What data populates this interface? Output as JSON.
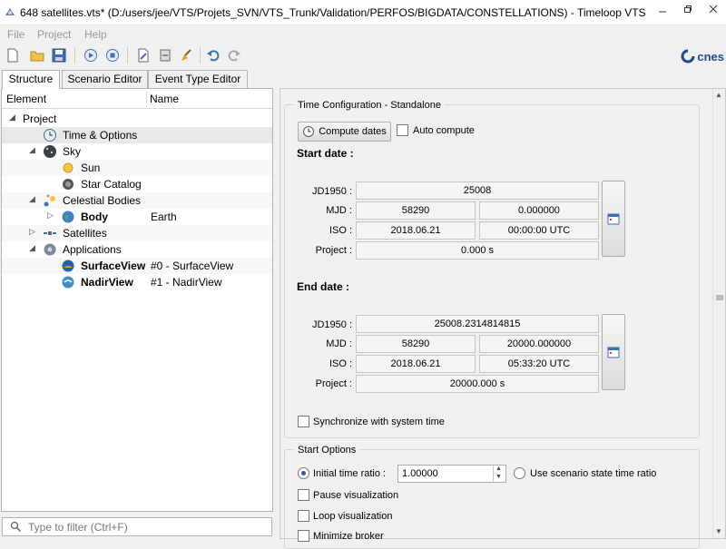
{
  "window": {
    "title": "648 satellites.vts* (D:/users/jee/VTS/Projets_SVN/VTS_Trunk/Validation/PERFOS/BIGDATA/CONSTELLATIONS) - Timeloop VTS ..."
  },
  "menu": [
    "File",
    "Project",
    "Help"
  ],
  "toolbar": {
    "brand": "cnes"
  },
  "tabs": [
    "Structure",
    "Scenario Editor",
    "Event Type Editor"
  ],
  "tree": {
    "header": {
      "element": "Element",
      "name": "Name"
    },
    "rows": [
      {
        "label": "Project",
        "name": "",
        "icon": "none"
      },
      {
        "label": "Time & Options",
        "name": "",
        "icon": "clock-icon"
      },
      {
        "label": "Sky",
        "name": "",
        "icon": "sky-icon"
      },
      {
        "label": "Sun",
        "name": "",
        "icon": "sun-icon"
      },
      {
        "label": "Star Catalog",
        "name": "",
        "icon": "star-catalog-icon"
      },
      {
        "label": "Celestial Bodies",
        "name": "",
        "icon": "celestial-bodies-icon"
      },
      {
        "label": "Body",
        "name": "Earth",
        "icon": "earth-icon"
      },
      {
        "label": "Satellites",
        "name": "",
        "icon": "satellites-icon"
      },
      {
        "label": "Applications",
        "name": "",
        "icon": "applications-icon"
      },
      {
        "label": "SurfaceView",
        "name": "#0 - SurfaceView",
        "icon": "surfaceview-icon"
      },
      {
        "label": "NadirView",
        "name": "#1 - NadirView",
        "icon": "nadirview-icon"
      }
    ],
    "filter_placeholder": "Type to filter (Ctrl+F)"
  },
  "time_config": {
    "group_title": "Time Configuration - Standalone",
    "compute_button": "Compute dates",
    "auto_compute": "Auto compute",
    "start": {
      "heading": "Start date :",
      "labels": {
        "jd1950": "JD1950 :",
        "mjd": "MJD :",
        "iso": "ISO :",
        "project": "Project :"
      },
      "jd1950": "25008",
      "mjd_day": "58290",
      "mjd_sec": "0.000000",
      "iso_date": "2018.06.21",
      "iso_time": "00:00:00 UTC",
      "project": "0.000 s"
    },
    "end": {
      "heading": "End date :",
      "labels": {
        "jd1950": "JD1950 :",
        "mjd": "MJD :",
        "iso": "ISO :",
        "project": "Project :"
      },
      "jd1950": "25008.2314814815",
      "mjd_day": "58290",
      "mjd_sec": "20000.000000",
      "iso_date": "2018.06.21",
      "iso_time": "05:33:20 UTC",
      "project": "20000.000 s"
    },
    "sync": "Synchronize with system time"
  },
  "start_options": {
    "group_title": "Start Options",
    "initial_ratio_label": "Initial time ratio :",
    "initial_ratio_value": "1.00000",
    "scenario_ratio_label": "Use scenario state time ratio",
    "pause": "Pause visualization",
    "loop": "Loop visualization",
    "minimize": "Minimize broker"
  }
}
